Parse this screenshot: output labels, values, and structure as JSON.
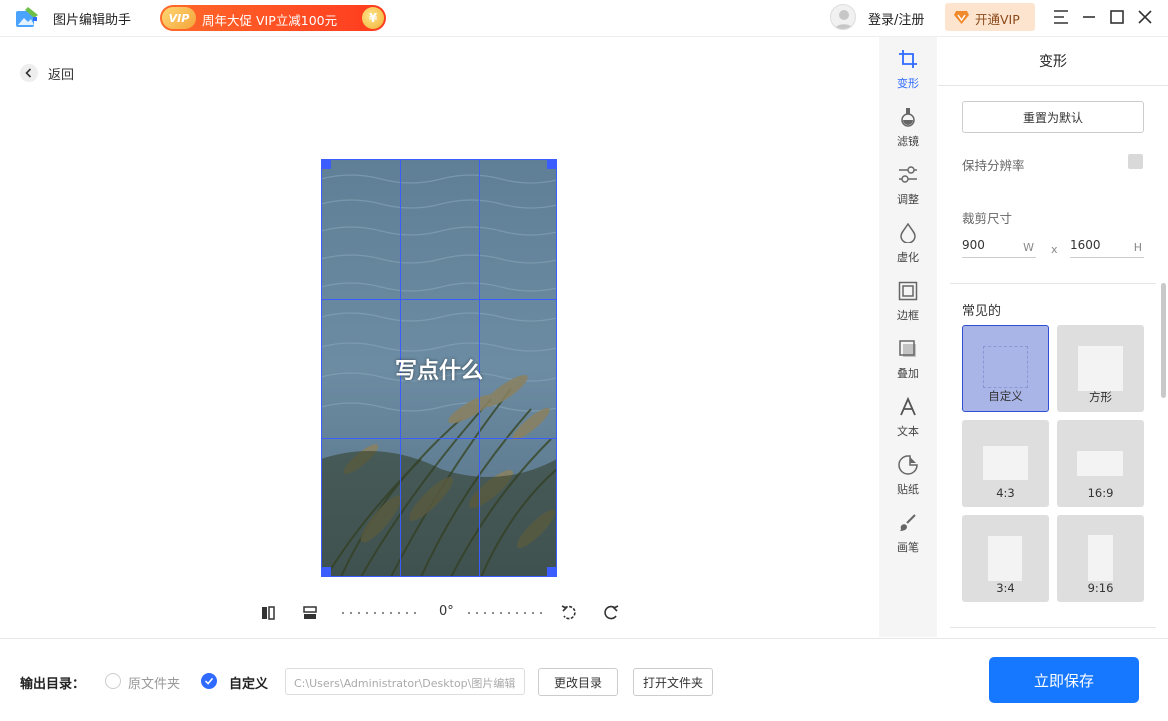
{
  "app": {
    "name": "图片编辑助手"
  },
  "promo": {
    "vip_badge": "VIP",
    "text": "周年大促 VIP立减100元",
    "coin": "¥"
  },
  "header": {
    "login": "登录/注册",
    "vip_button": "开通VIP"
  },
  "nav": {
    "back": "返回"
  },
  "canvas": {
    "overlay_text": "写点什么",
    "rotation": "0°"
  },
  "tools": [
    {
      "label": "变形",
      "icon": "crop-icon",
      "active": true
    },
    {
      "label": "滤镜",
      "icon": "filter-icon"
    },
    {
      "label": "调整",
      "icon": "adjust-icon"
    },
    {
      "label": "虚化",
      "icon": "blur-icon"
    },
    {
      "label": "边框",
      "icon": "border-icon"
    },
    {
      "label": "叠加",
      "icon": "overlay-icon"
    },
    {
      "label": "文本",
      "icon": "text-icon"
    },
    {
      "label": "贴纸",
      "icon": "sticker-icon"
    },
    {
      "label": "画笔",
      "icon": "brush-icon"
    }
  ],
  "panel": {
    "title": "变形",
    "reset": "重置为默认",
    "keep_resolution": "保持分辨率",
    "crop_size": "裁剪尺寸",
    "width": "900",
    "width_unit": "W",
    "times": "x",
    "height": "1600",
    "height_unit": "H",
    "common": "常见的",
    "ratios": [
      {
        "label": "自定义",
        "active": true
      },
      {
        "label": "方形"
      },
      {
        "label": "4:3"
      },
      {
        "label": "16:9"
      },
      {
        "label": "3:4"
      },
      {
        "label": "9:16"
      }
    ]
  },
  "bottom": {
    "output_label": "输出目录：",
    "option_original": "原文件夹",
    "option_custom": "自定义",
    "path": "C:\\Users\\Administrator\\Desktop\\图片编辑",
    "change_dir": "更改目录",
    "open_folder": "打开文件夹",
    "save": "立即保存"
  },
  "colors": {
    "accent": "#1677ff",
    "crop_grid": "#3b5cff",
    "promo": "#ff3b1f"
  }
}
